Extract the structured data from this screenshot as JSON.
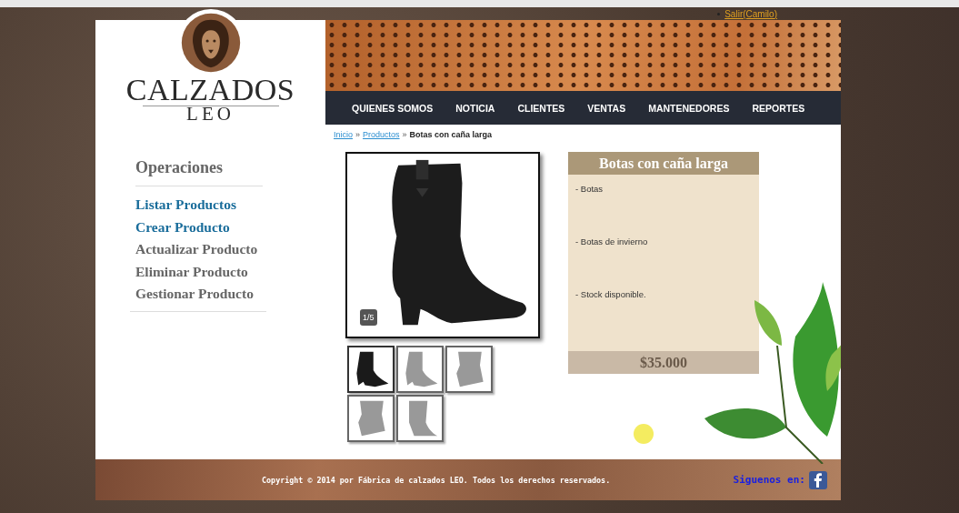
{
  "user_link": "Salir(Camilo)",
  "logo": {
    "name": "CALZADOS",
    "subtitle": "LEO"
  },
  "nav": [
    {
      "label": "QUIENES SOMOS"
    },
    {
      "label": "NOTICIA"
    },
    {
      "label": "CLIENTES"
    },
    {
      "label": "VENTAS"
    },
    {
      "label": "MANTENEDORES"
    },
    {
      "label": "REPORTES"
    }
  ],
  "breadcrumb": [
    {
      "label": "Inicio",
      "link": true
    },
    {
      "label": "Productos",
      "link": true
    },
    {
      "label": "Botas con caña larga",
      "link": false
    }
  ],
  "breadcrumb_separator": "»",
  "sidebar": {
    "title": "Operaciones",
    "items": [
      {
        "label": "Listar Productos",
        "disabled": false
      },
      {
        "label": "Crear Producto",
        "disabled": false
      },
      {
        "label": "Actualizar Producto",
        "disabled": true
      },
      {
        "label": "Eliminar Producto",
        "disabled": true
      },
      {
        "label": "Gestionar Producto",
        "disabled": true
      }
    ]
  },
  "gallery": {
    "counter": "1/5",
    "thumbnails": [
      {
        "selected": true
      },
      {
        "selected": false
      },
      {
        "selected": false
      },
      {
        "selected": false
      },
      {
        "selected": false
      }
    ]
  },
  "product": {
    "title": "Botas con caña larga",
    "features": [
      "- Botas",
      "- Botas de invierno",
      "- Stock disponible."
    ],
    "price": "$35.000"
  },
  "footer": {
    "copyright": "Copyright © 2014 por Fábrica de calzados LEO. Todos los derechos reservados.",
    "follow": "Siguenos en:"
  }
}
